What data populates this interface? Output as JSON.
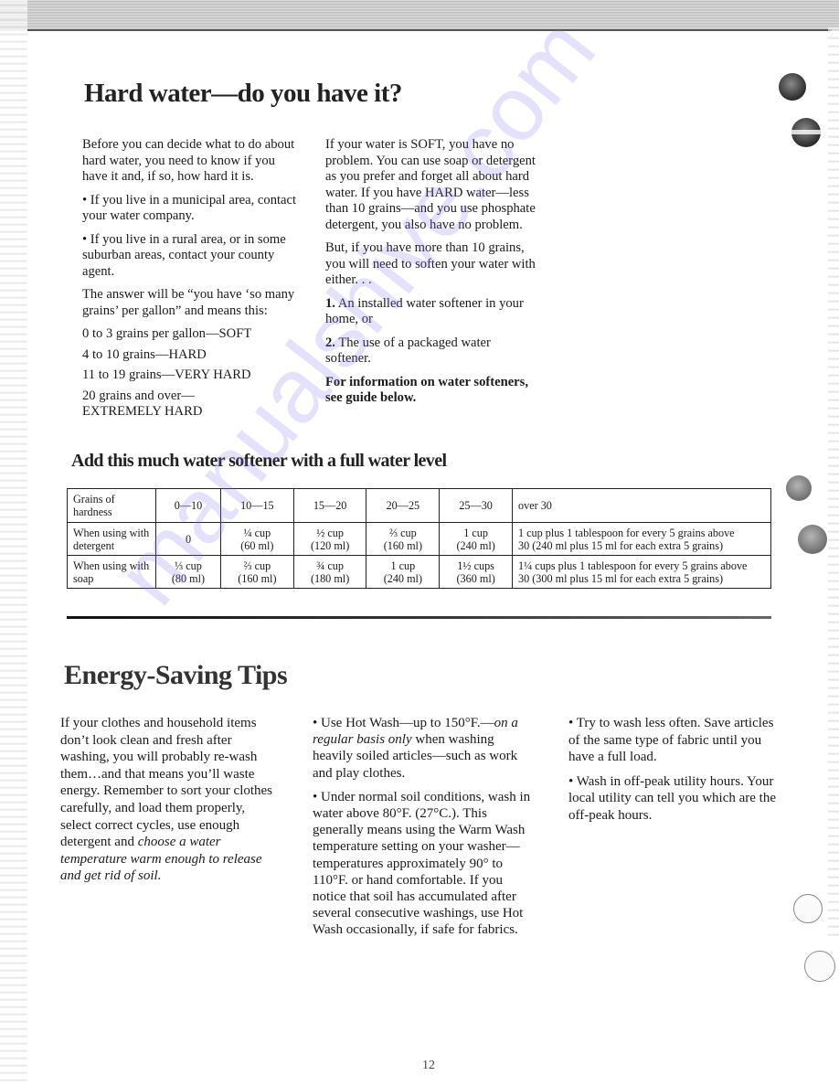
{
  "hard_water": {
    "title": "Hard water—do you have it?",
    "left_column": {
      "intro": "Before you can decide what to do about hard water, you need to know if you have it and, if so, how hard it is.",
      "bullet_municipal": "If you live in a municipal area, contact your water company.",
      "bullet_rural": "If you live in a rural area, or in some suburban areas, contact your county agent.",
      "answer": "The answer will be “you have ‘so many grains’ per gallon” and means this:",
      "scale": [
        "0 to 3 grains per gallon—SOFT",
        "4 to 10 grains—HARD",
        "11 to 19 grains—VERY HARD",
        "20 grains and over—",
        "EXTREMELY HARD"
      ]
    },
    "right_column": {
      "soft_paragraph": "If your water is SOFT, you have no problem. You can use soap or detergent as you prefer and forget all about hard water. If you have HARD water—less than 10 grains—and you use phosphate detergent, you also have no problem.",
      "more_than_10": "But, if you have more than 10 grains, you will need to soften your water with either. . .",
      "option1_number": "1.",
      "option1_text": "An installed water softener in your home, or",
      "option2_number": "2.",
      "option2_text": "The use of a packaged water softener.",
      "info_note": "For information on water softeners, see guide below."
    }
  },
  "softener_table": {
    "title": "Add this much water softener with a full water level",
    "header_label": "Grains of hardness",
    "ranges": [
      "0—10",
      "10—15",
      "15—20",
      "20—25",
      "25—30",
      "over 30"
    ],
    "rows": [
      {
        "label": "When using with detergent",
        "cells": [
          {
            "line1": "0",
            "line2": ""
          },
          {
            "line1": "¼ cup",
            "line2": "(60 ml)"
          },
          {
            "line1": "½ cup",
            "line2": "(120 ml)"
          },
          {
            "line1": "⅔ cup",
            "line2": "(160 ml)"
          },
          {
            "line1": "1 cup",
            "line2": "(240 ml)"
          },
          {
            "line1": "1 cup plus 1 tablespoon for every 5 grains above",
            "line2": "30 (240 ml plus 15 ml for each extra 5 grains)"
          }
        ]
      },
      {
        "label": "When using with soap",
        "cells": [
          {
            "line1": "⅓ cup",
            "line2": "(80 ml)"
          },
          {
            "line1": "⅔ cup",
            "line2": "(160 ml)"
          },
          {
            "line1": "¾ cup",
            "line2": "(180 ml)"
          },
          {
            "line1": "1 cup",
            "line2": "(240 ml)"
          },
          {
            "line1": "1½ cups",
            "line2": "(360 ml)"
          },
          {
            "line1": "1¼ cups plus 1 tablespoon for every 5 grains above",
            "line2": "30 (300 ml plus 15 ml for each extra 5 grains)"
          }
        ]
      }
    ]
  },
  "energy_tips": {
    "title": "Energy-Saving Tips",
    "intro_plain": "If your clothes and household items don’t look clean and fresh after washing, you will probably re-wash them…and that means you’ll waste energy. Remember to sort your clothes carefully, and load them properly, select correct cycles, use enough detergent and ",
    "intro_italic": "choose a water temperature warm enough to release and get rid of soil.",
    "hot_wash_plain": "Use Hot Wash—up to 150°F.—",
    "hot_wash_italic": "on a regular basis only",
    "hot_wash_rest": " when washing heavily soiled articles—such as work and play clothes.",
    "normal_soil": "Under normal soil conditions, wash in water above 80°F. (27°C.). This generally means using the Warm Wash temperature setting on your washer—temperatures approximately 90° to 110°F. or hand comfortable. If you notice that soil has accumulated after several consecutive washings, use Hot Wash occasionally, if safe for fabrics.",
    "wash_less": "Try to wash less often. Save articles of the same type of fabric until you have a full load.",
    "off_peak": "Wash in off-peak utility hours. Your local utility can tell you which are the off-peak hours."
  },
  "bullet_glyph": "•",
  "page_number": "12",
  "watermark": "manualshive.com"
}
